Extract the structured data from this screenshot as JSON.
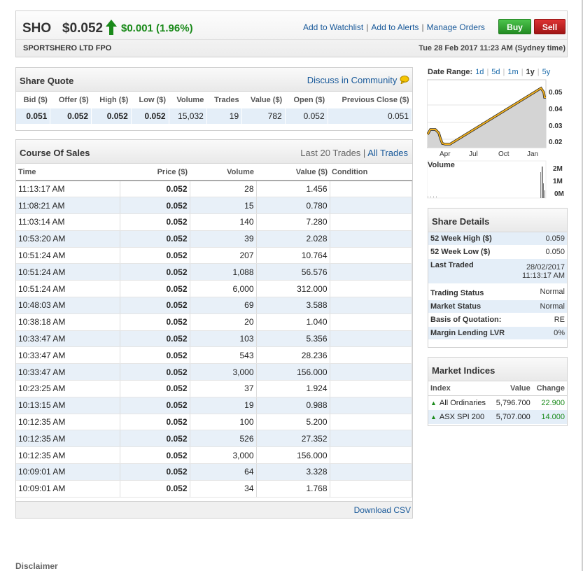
{
  "header": {
    "code": "SHO",
    "price": "$0.052",
    "change": "$0.001 (1.96%)",
    "company": "SPORTSHERO LTD FPO",
    "datetime": "Tue 28 Feb 2017 11:23 AM (Sydney time)",
    "links": [
      "Add to Watchlist",
      "Add to Alerts",
      "Manage Orders"
    ],
    "buy_label": "Buy",
    "sell_label": "Sell",
    "up_color": "#1a8a1a"
  },
  "share_quote": {
    "title": "Share Quote",
    "community_link": "Discuss in Community",
    "headers": [
      "Bid ($)",
      "Offer ($)",
      "High ($)",
      "Low ($)",
      "Volume",
      "Trades",
      "Value ($)",
      "Open ($)",
      "Previous Close ($)"
    ],
    "values": [
      "0.051",
      "0.052",
      "0.052",
      "0.052",
      "15,032",
      "19",
      "782",
      "0.052",
      "0.051"
    ]
  },
  "course_of_sales": {
    "title": "Course Of Sales",
    "trades_label": "Last 20 Trades",
    "all_trades_link": "All Trades",
    "headers": [
      "Time",
      "Price ($)",
      "Volume",
      "Value ($)",
      "Condition"
    ],
    "rows": [
      [
        "11:13:17 AM",
        "0.052",
        "28",
        "1.456",
        ""
      ],
      [
        "11:08:21 AM",
        "0.052",
        "15",
        "0.780",
        ""
      ],
      [
        "11:03:14 AM",
        "0.052",
        "140",
        "7.280",
        ""
      ],
      [
        "10:53:20 AM",
        "0.052",
        "39",
        "2.028",
        ""
      ],
      [
        "10:51:24 AM",
        "0.052",
        "207",
        "10.764",
        ""
      ],
      [
        "10:51:24 AM",
        "0.052",
        "1,088",
        "56.576",
        ""
      ],
      [
        "10:51:24 AM",
        "0.052",
        "6,000",
        "312.000",
        ""
      ],
      [
        "10:48:03 AM",
        "0.052",
        "69",
        "3.588",
        ""
      ],
      [
        "10:38:18 AM",
        "0.052",
        "20",
        "1.040",
        ""
      ],
      [
        "10:33:47 AM",
        "0.052",
        "103",
        "5.356",
        ""
      ],
      [
        "10:33:47 AM",
        "0.052",
        "543",
        "28.236",
        ""
      ],
      [
        "10:33:47 AM",
        "0.052",
        "3,000",
        "156.000",
        ""
      ],
      [
        "10:23:25 AM",
        "0.052",
        "37",
        "1.924",
        ""
      ],
      [
        "10:13:15 AM",
        "0.052",
        "19",
        "0.988",
        ""
      ],
      [
        "10:12:35 AM",
        "0.052",
        "100",
        "5.200",
        ""
      ],
      [
        "10:12:35 AM",
        "0.052",
        "526",
        "27.352",
        ""
      ],
      [
        "10:12:35 AM",
        "0.052",
        "3,000",
        "156.000",
        ""
      ],
      [
        "10:09:01 AM",
        "0.052",
        "64",
        "3.328",
        ""
      ],
      [
        "10:09:01 AM",
        "0.052",
        "34",
        "1.768",
        ""
      ]
    ],
    "download_link": "Download CSV"
  },
  "chart": {
    "range_label": "Date Range:",
    "range_options": [
      "1d",
      "5d",
      "1m",
      "1y",
      "5y"
    ],
    "selected_range": "1y",
    "price_ticks": [
      "0.05",
      "0.04",
      "0.03",
      "0.02"
    ],
    "x_ticks": [
      "Apr",
      "Jul",
      "Oct",
      "Jan"
    ],
    "volume_label": "Volume",
    "volume_ticks": [
      "2M",
      "1M",
      "0M"
    ]
  },
  "share_details": {
    "title": "Share Details",
    "rows": [
      [
        "52 Week High ($)",
        "0.059"
      ],
      [
        "52 Week Low ($)",
        "0.050"
      ],
      [
        "Last Traded",
        "28/02/2017 11:13:17 AM"
      ],
      [
        "Trading Status",
        "Normal"
      ],
      [
        "Market Status",
        "Normal"
      ],
      [
        "Basis of Quotation:",
        "RE"
      ],
      [
        "Margin Lending LVR",
        "0%"
      ]
    ]
  },
  "market_indices": {
    "title": "Market Indices",
    "headers": [
      "Index",
      "Value",
      "Change"
    ],
    "rows": [
      [
        "All Ordinaries",
        "5,796.700",
        "22.900"
      ],
      [
        "ASX SPI 200",
        "5,707.000",
        "14.000"
      ]
    ]
  },
  "footer": {
    "disclaimer": "Disclaimer"
  }
}
